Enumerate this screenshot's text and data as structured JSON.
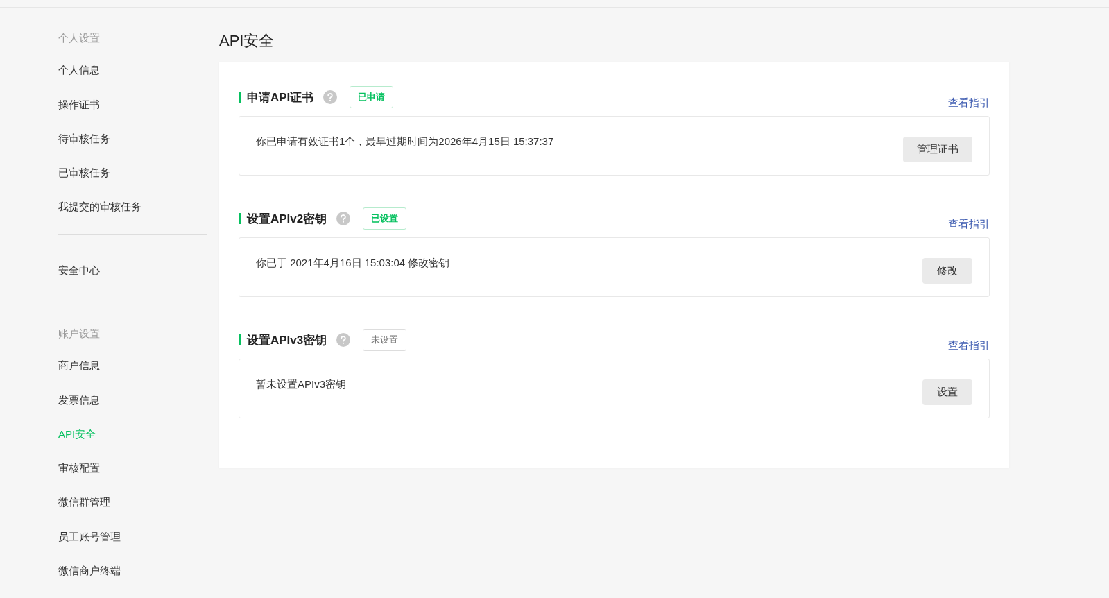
{
  "sidebar": {
    "groups": [
      {
        "heading": "个人设置",
        "items": [
          {
            "label": "个人信息",
            "selected": false
          },
          {
            "label": "操作证书",
            "selected": false
          },
          {
            "label": "待审核任务",
            "selected": false
          },
          {
            "label": "已审核任务",
            "selected": false
          },
          {
            "label": "我提交的审核任务",
            "selected": false
          }
        ]
      },
      {
        "items": [
          {
            "label": "安全中心",
            "selected": false
          }
        ]
      },
      {
        "heading": "账户设置",
        "items": [
          {
            "label": "商户信息",
            "selected": false
          },
          {
            "label": "发票信息",
            "selected": false
          },
          {
            "label": "API安全",
            "selected": true
          },
          {
            "label": "审核配置",
            "selected": false
          },
          {
            "label": "微信群管理",
            "selected": false
          },
          {
            "label": "员工账号管理",
            "selected": false
          },
          {
            "label": "微信商户终端",
            "selected": false
          }
        ]
      }
    ]
  },
  "page_title": "API安全",
  "sections": [
    {
      "title": "申请API证书",
      "status": {
        "label": "已申请",
        "done": true
      },
      "guide_link": "查看指引",
      "message": "你已申请有效证书1个，最早过期时间为2026年4月15日 15:37:37",
      "button": "管理证书"
    },
    {
      "title": "设置APIv2密钥",
      "status": {
        "label": "已设置",
        "done": true
      },
      "guide_link": "查看指引",
      "message": "你已于 2021年4月16日 15:03:04 修改密钥",
      "button": "修改"
    },
    {
      "title": "设置APIv3密钥",
      "status": {
        "label": "未设置",
        "done": false
      },
      "guide_link": "查看指引",
      "message": "暂未设置APIv3密钥",
      "button": "设置"
    }
  ]
}
